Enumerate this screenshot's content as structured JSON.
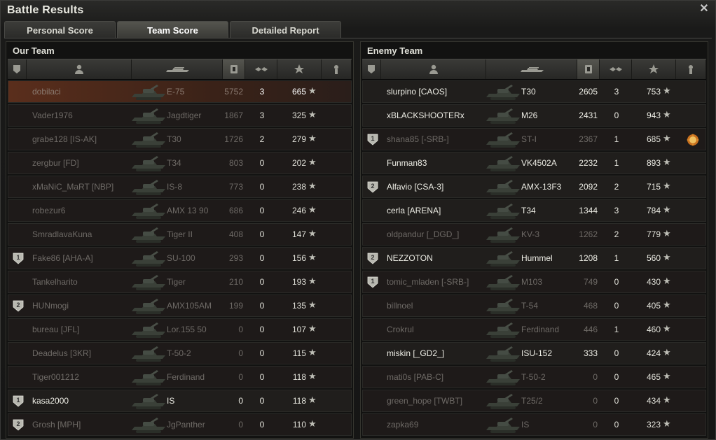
{
  "window": {
    "title": "Battle Results"
  },
  "tabs": [
    {
      "label": "Personal Score",
      "active": false
    },
    {
      "label": "Team Score",
      "active": true
    },
    {
      "label": "Detailed Report",
      "active": false
    }
  ],
  "header_icons": [
    "badge-column-icon",
    "player-column-icon",
    "vehicle-column-icon",
    "damage-sort-icon",
    "kills-column-icon",
    "xp-column-icon",
    "medal-column-icon"
  ],
  "our_team": {
    "title": "Our Team",
    "rows": [
      {
        "name": "dobilaci",
        "tank": "E-75",
        "damage": "5752",
        "kills": "3",
        "xp": "665",
        "state": "self",
        "badge": "",
        "medal": false
      },
      {
        "name": "Vader1976",
        "tank": "Jagdtiger",
        "damage": "1867",
        "kills": "3",
        "xp": "325",
        "state": "dead",
        "badge": "",
        "medal": false
      },
      {
        "name": "grabe128 [IS-AK]",
        "tank": "T30",
        "damage": "1726",
        "kills": "2",
        "xp": "279",
        "state": "dead",
        "badge": "",
        "medal": false
      },
      {
        "name": "zergbur [FD]",
        "tank": "T34",
        "damage": "803",
        "kills": "0",
        "xp": "202",
        "state": "dead",
        "badge": "",
        "medal": false
      },
      {
        "name": "xMaNiC_MaRT [NBP]",
        "tank": "IS-8",
        "damage": "773",
        "kills": "0",
        "xp": "238",
        "state": "dead",
        "badge": "",
        "medal": false
      },
      {
        "name": "robezur6",
        "tank": "AMX 13 90",
        "damage": "686",
        "kills": "0",
        "xp": "246",
        "state": "dead",
        "badge": "",
        "medal": false
      },
      {
        "name": "SmradlavaKuna",
        "tank": "Tiger II",
        "damage": "408",
        "kills": "0",
        "xp": "147",
        "state": "dead",
        "badge": "",
        "medal": false
      },
      {
        "name": "Fake86 [AHA-A]",
        "tank": "SU-100",
        "damage": "293",
        "kills": "0",
        "xp": "156",
        "state": "dead",
        "badge": "1",
        "medal": false
      },
      {
        "name": "Tankelharito",
        "tank": "Tiger",
        "damage": "210",
        "kills": "0",
        "xp": "193",
        "state": "dead",
        "badge": "",
        "medal": false
      },
      {
        "name": "HUNmogi",
        "tank": "AMX105AM",
        "damage": "199",
        "kills": "0",
        "xp": "135",
        "state": "dead",
        "badge": "2",
        "medal": false
      },
      {
        "name": "bureau [JFL]",
        "tank": "Lor.155 50",
        "damage": "0",
        "kills": "0",
        "xp": "107",
        "state": "dead",
        "badge": "",
        "medal": false
      },
      {
        "name": "Deadelus [3KR]",
        "tank": "T-50-2",
        "damage": "0",
        "kills": "0",
        "xp": "115",
        "state": "dead",
        "badge": "",
        "medal": false
      },
      {
        "name": "Tiger001212",
        "tank": "Ferdinand",
        "damage": "0",
        "kills": "0",
        "xp": "118",
        "state": "dead",
        "badge": "",
        "medal": false
      },
      {
        "name": "kasa2000",
        "tank": "IS",
        "damage": "0",
        "kills": "0",
        "xp": "118",
        "state": "alive",
        "badge": "1",
        "medal": false
      },
      {
        "name": "Grosh [MPH]",
        "tank": "JgPanther",
        "damage": "0",
        "kills": "0",
        "xp": "110",
        "state": "dead",
        "badge": "2",
        "medal": false
      }
    ]
  },
  "enemy_team": {
    "title": "Enemy Team",
    "rows": [
      {
        "name": "slurpino [CAOS]",
        "tank": "T30",
        "damage": "2605",
        "kills": "3",
        "xp": "753",
        "state": "alive",
        "badge": "",
        "medal": false
      },
      {
        "name": "xBLACKSHOOTERx",
        "tank": "M26",
        "damage": "2431",
        "kills": "0",
        "xp": "943",
        "state": "alive",
        "badge": "",
        "medal": false
      },
      {
        "name": "shana85 [-SRB-]",
        "tank": "ST-I",
        "damage": "2367",
        "kills": "1",
        "xp": "685",
        "state": "dead",
        "badge": "1",
        "medal": true
      },
      {
        "name": "Funman83",
        "tank": "VK4502A",
        "damage": "2232",
        "kills": "1",
        "xp": "893",
        "state": "alive",
        "badge": "",
        "medal": false
      },
      {
        "name": "Alfavio [CSA-3]",
        "tank": "AMX-13F3",
        "damage": "2092",
        "kills": "2",
        "xp": "715",
        "state": "alive",
        "badge": "2",
        "medal": false
      },
      {
        "name": "cerla [ARENA]",
        "tank": "T34",
        "damage": "1344",
        "kills": "3",
        "xp": "784",
        "state": "alive",
        "badge": "",
        "medal": false
      },
      {
        "name": "oldpandur [_DGD_]",
        "tank": "KV-3",
        "damage": "1262",
        "kills": "2",
        "xp": "779",
        "state": "dead",
        "badge": "",
        "medal": false
      },
      {
        "name": "NEZZOTON",
        "tank": "Hummel",
        "damage": "1208",
        "kills": "1",
        "xp": "560",
        "state": "alive",
        "badge": "2",
        "medal": false
      },
      {
        "name": "tomic_mladen [-SRB-]",
        "tank": "M103",
        "damage": "749",
        "kills": "0",
        "xp": "430",
        "state": "dead",
        "badge": "1",
        "medal": false
      },
      {
        "name": "billnoel",
        "tank": "T-54",
        "damage": "468",
        "kills": "0",
        "xp": "405",
        "state": "dead",
        "badge": "",
        "medal": false
      },
      {
        "name": "Crokrul",
        "tank": "Ferdinand",
        "damage": "446",
        "kills": "1",
        "xp": "460",
        "state": "dead",
        "badge": "",
        "medal": false
      },
      {
        "name": "miskin [_GD2_]",
        "tank": "ISU-152",
        "damage": "333",
        "kills": "0",
        "xp": "424",
        "state": "alive",
        "badge": "",
        "medal": false
      },
      {
        "name": "mati0s [PAB-C]",
        "tank": "T-50-2",
        "damage": "0",
        "kills": "0",
        "xp": "465",
        "state": "dead",
        "badge": "",
        "medal": false
      },
      {
        "name": "green_hope [TWBT]",
        "tank": "T25/2",
        "damage": "0",
        "kills": "0",
        "xp": "434",
        "state": "dead",
        "badge": "",
        "medal": false
      },
      {
        "name": "zapka69",
        "tank": "IS",
        "damage": "0",
        "kills": "0",
        "xp": "323",
        "state": "dead",
        "badge": "",
        "medal": false
      }
    ]
  },
  "colors": {
    "self_row": "#5a2e1c",
    "alive_text": "#ecece4",
    "dead_text": "#6e6a66",
    "panel_bg": "#121211"
  }
}
